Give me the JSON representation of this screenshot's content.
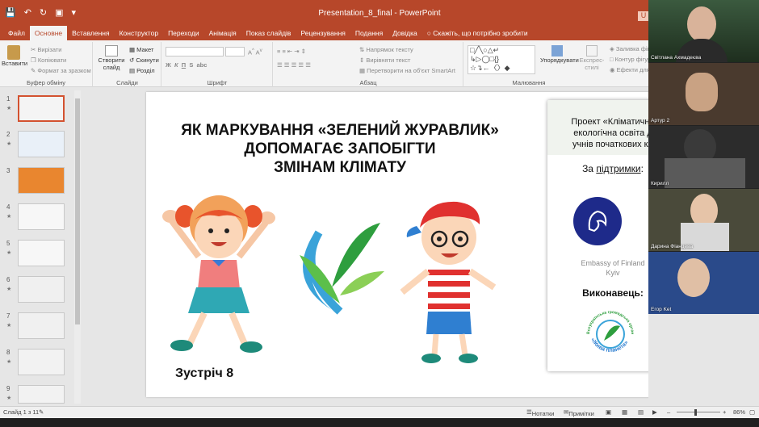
{
  "titlebar": {
    "doc_title": "Presentation_8_final  -  PowerPoint",
    "user_initial": "U"
  },
  "menu": {
    "tabs": [
      "Файл",
      "Основне",
      "Вставлення",
      "Конструктор",
      "Переходи",
      "Анімація",
      "Показ слайдів",
      "Рецензування",
      "Подання",
      "Довідка"
    ],
    "active_tab": "Основне",
    "tell_me": "Скажіть, що потрібно зробити"
  },
  "ribbon": {
    "clipboard": {
      "paste": "Вставити",
      "cut": "Вирізати",
      "copy": "Копіювати",
      "format_painter": "Формат за зразком",
      "label": "Буфер обміну"
    },
    "slides": {
      "new_slide": "Створити слайд",
      "layout": "Макет",
      "reset": "Скинути",
      "section": "Розділ",
      "label": "Слайди"
    },
    "font": {
      "label": "Шрифт",
      "bold": "Ж",
      "italic": "К",
      "underline": "П",
      "strike": "S",
      "shadow": "abc"
    },
    "paragraph": {
      "label": "Абзац",
      "text_direction": "Напрямок тексту",
      "align_text": "Вирівняти текст",
      "smartart": "Перетворити на об'єкт SmartArt"
    },
    "drawing": {
      "label": "Малювання",
      "arrange": "Упорядкувати",
      "quick_styles": "Експрес-стилі",
      "shape_fill": "Заливка фігури",
      "shape_outline": "Контур фігури",
      "shape_effects": "Ефекти для фігур"
    }
  },
  "thumbnails": [
    {
      "num": "1",
      "star": "★"
    },
    {
      "num": "2",
      "star": "★"
    },
    {
      "num": "3",
      "star": ""
    },
    {
      "num": "4",
      "star": "★"
    },
    {
      "num": "5",
      "star": "★"
    },
    {
      "num": "6",
      "star": "★"
    },
    {
      "num": "7",
      "star": "★"
    },
    {
      "num": "8",
      "star": "★"
    },
    {
      "num": "9",
      "star": "★"
    }
  ],
  "slide": {
    "title_line1": "ЯК МАРКУВАННЯ «ЗЕЛЕНИЙ ЖУРАВЛИК»",
    "title_line2": "ДОПОМАГАЄ ЗАПОБІГТИ",
    "title_line3": "ЗМІНАМ КЛІМАТУ",
    "meeting": "Зустріч 8",
    "panel": {
      "project_line1": "Проект «Кліматична",
      "project_line2": "екологічна освіта д",
      "project_line3": "учнів початкових кл",
      "support_prefix": "За ",
      "support_link": "підтримки",
      "support_suffix": ":",
      "embassy_line1": "Embassy of Finland",
      "embassy_line2": "Kyiv",
      "executor": "Виконавець:",
      "ngo_top": "Всеукраїнська громадська організація",
      "ngo_bottom": "«Жива планета»"
    }
  },
  "status": {
    "slide_of": "Слайд 1 з 11",
    "notes": "Нотатки",
    "comments": "Примітки",
    "zoom": "86%"
  },
  "participants": [
    {
      "name": "Світлана Ахмадеєва"
    },
    {
      "name": "Артур 2"
    },
    {
      "name": "Кирилл"
    },
    {
      "name": "Дарина Фіанцева"
    },
    {
      "name": "Егор Ket"
    }
  ],
  "colors": {
    "accent": "#b7472a",
    "selected_thumb": "#d35230",
    "panel_bg": "#f0f3ee",
    "embassy_blue": "#1e2a8a"
  }
}
